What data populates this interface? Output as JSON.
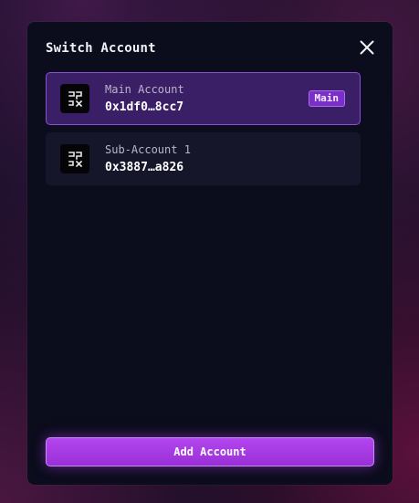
{
  "modal": {
    "title": "Switch Account",
    "close_icon": "close-icon"
  },
  "accounts": [
    {
      "name": "Main Account",
      "address": "0x1df0…8cc7",
      "badge": "Main",
      "active": true,
      "avatar_icon": "wallet-logo-icon"
    },
    {
      "name": "Sub-Account 1",
      "address": "0x3887…a826",
      "badge": "",
      "active": false,
      "avatar_icon": "wallet-logo-icon"
    }
  ],
  "footer": {
    "add_button_label": "Add Account"
  },
  "colors": {
    "accent": "#9a2fd8",
    "active_card": "#3b1f66",
    "modal_bg": "#0b0c1c"
  }
}
